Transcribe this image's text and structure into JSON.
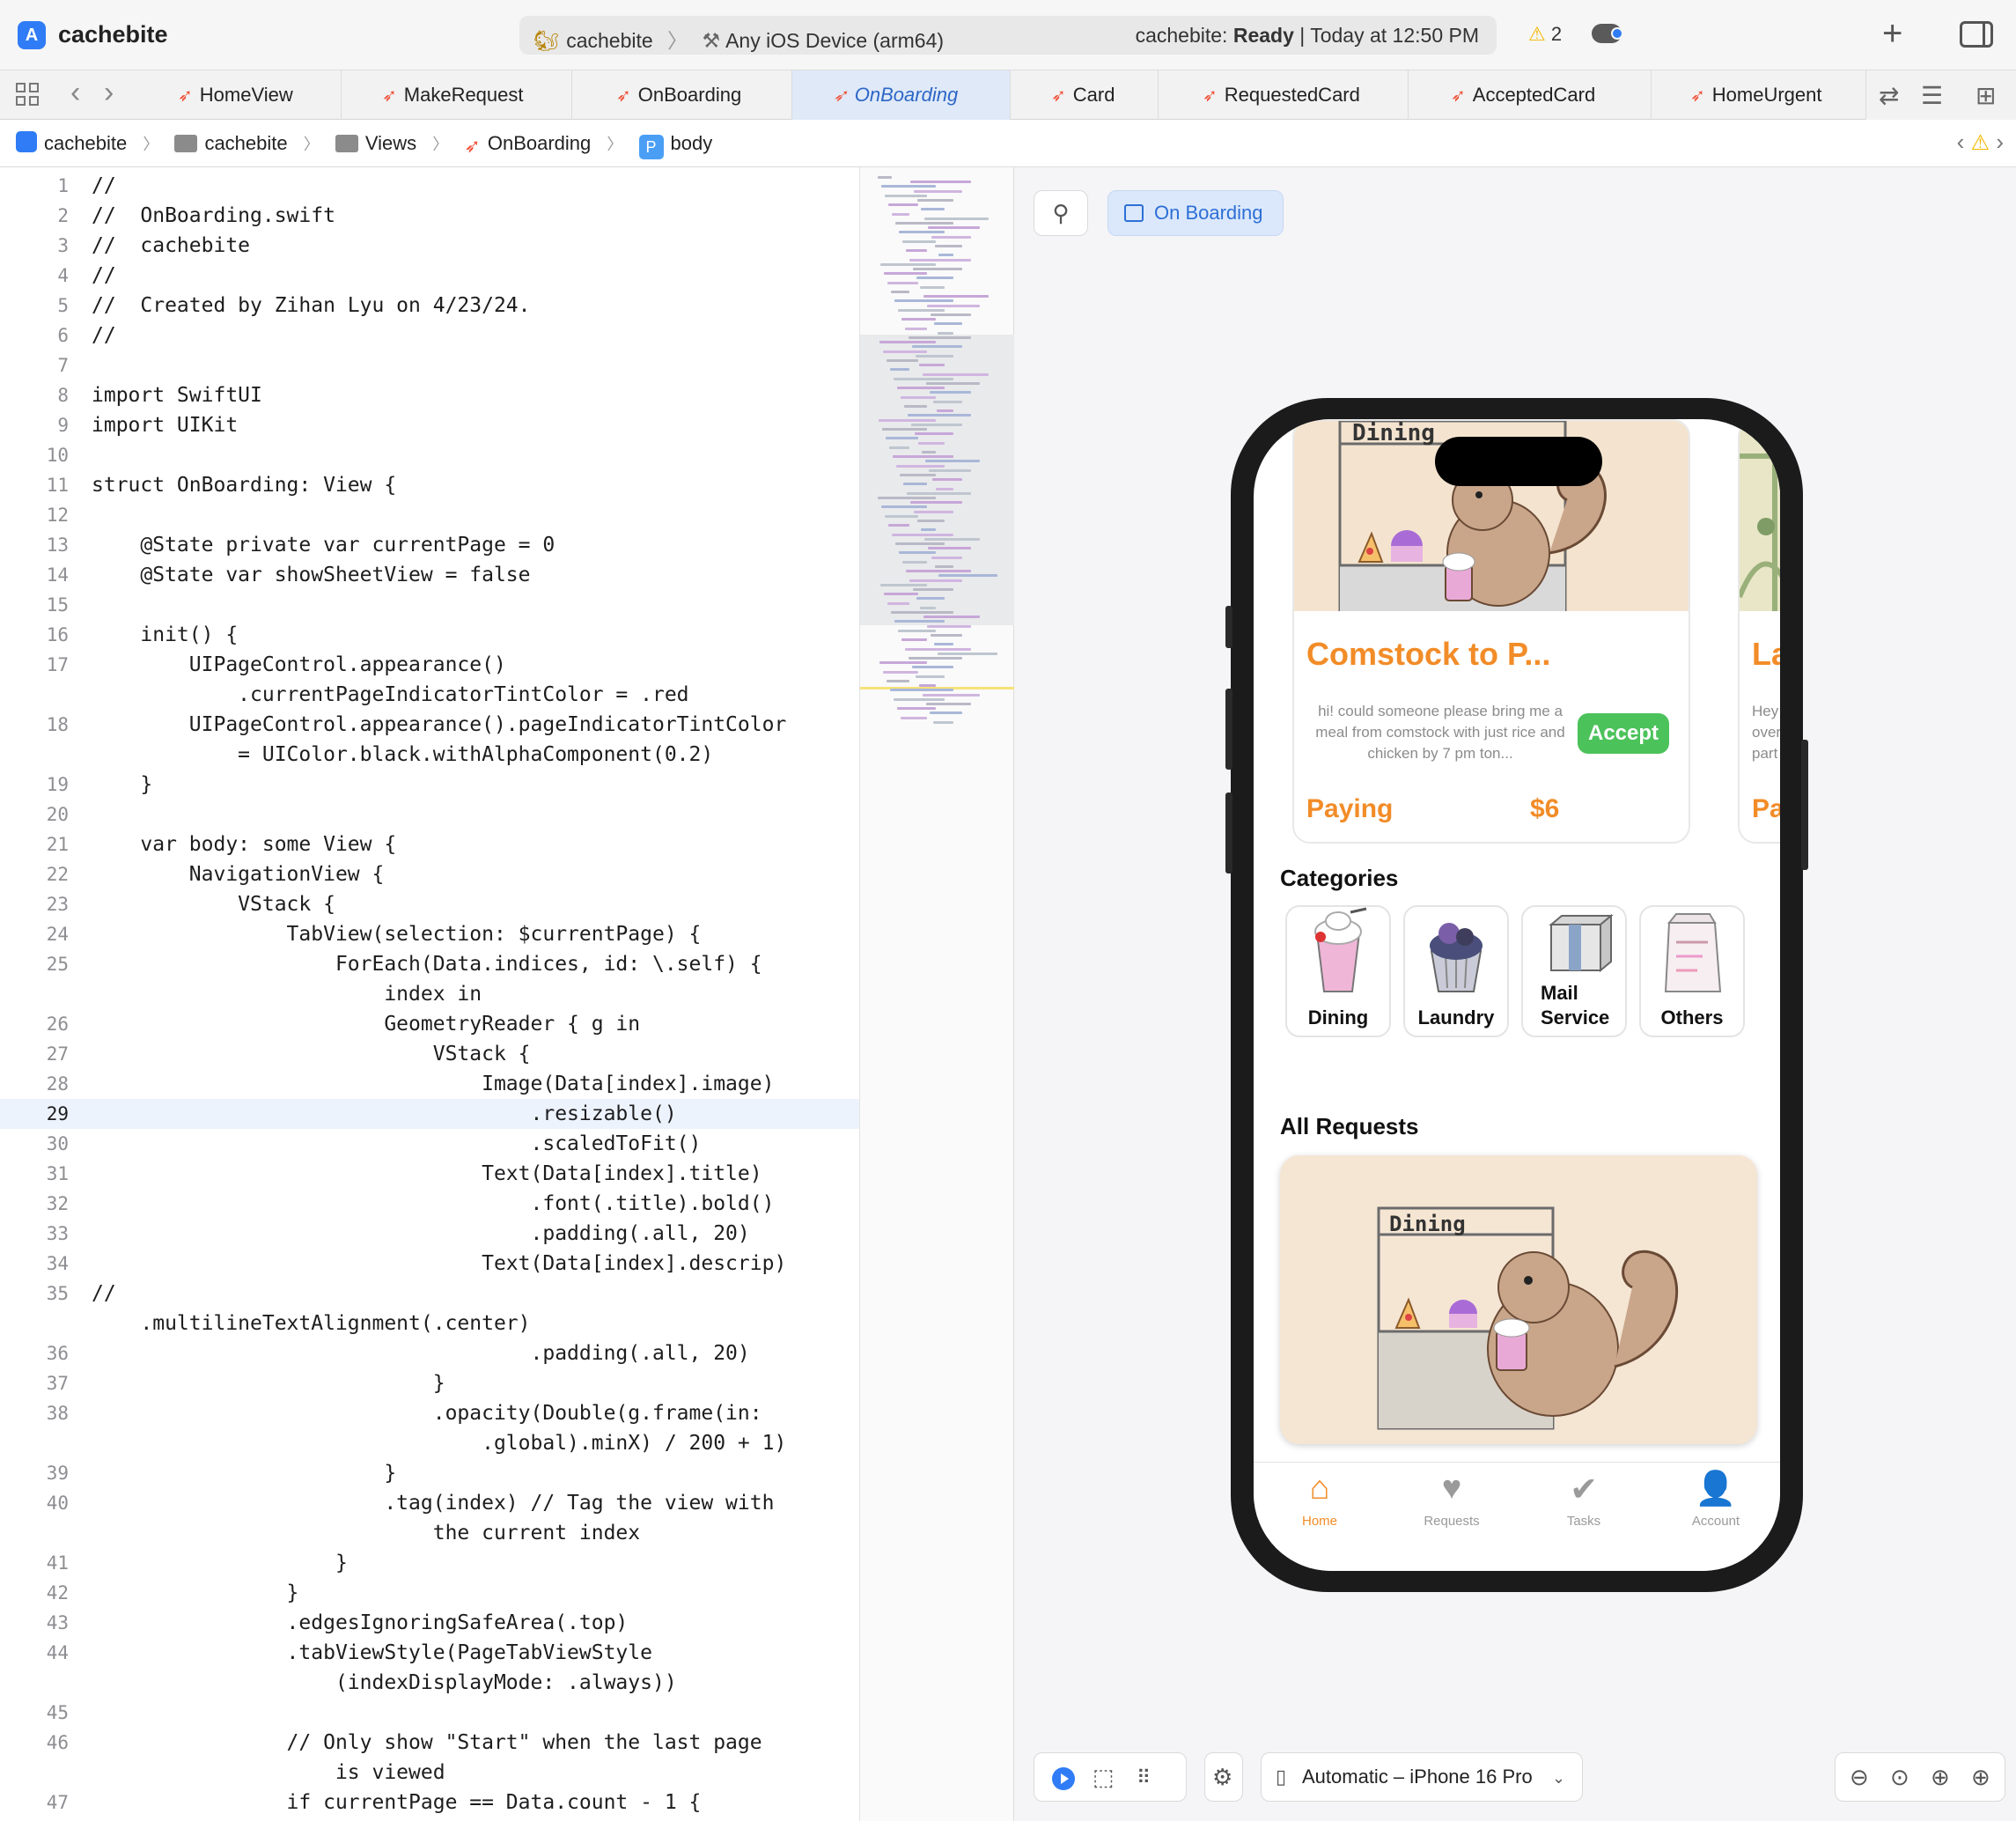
{
  "titlebar": {
    "app_name": "cachebite",
    "scheme": "cachebite",
    "destination": "Any iOS Device (arm64)",
    "status_project": "cachebite:",
    "status_state": "Ready",
    "status_time": "| Today at 12:50 PM",
    "warning_count": "2"
  },
  "tabs": [
    {
      "label": "HomeView"
    },
    {
      "label": "MakeRequest"
    },
    {
      "label": "OnBoarding"
    },
    {
      "label": "OnBoarding"
    },
    {
      "label": "Card"
    },
    {
      "label": "RequestedCard"
    },
    {
      "label": "AcceptedCard"
    },
    {
      "label": "HomeUrgent"
    }
  ],
  "breadcrumb": [
    "cachebite",
    "cachebite",
    "Views",
    "OnBoarding",
    "body"
  ],
  "editor": {
    "lines": [
      {
        "n": "1",
        "t": "//"
      },
      {
        "n": "2",
        "t": "//  OnBoarding.swift"
      },
      {
        "n": "3",
        "t": "//  cachebite"
      },
      {
        "n": "4",
        "t": "//"
      },
      {
        "n": "5",
        "t": "//  Created by Zihan Lyu on 4/23/24."
      },
      {
        "n": "6",
        "t": "//"
      },
      {
        "n": "7",
        "t": ""
      },
      {
        "n": "8",
        "t": "import SwiftUI"
      },
      {
        "n": "9",
        "t": "import UIKit"
      },
      {
        "n": "10",
        "t": ""
      },
      {
        "n": "11",
        "t": "struct OnBoarding: View {"
      },
      {
        "n": "12",
        "t": ""
      },
      {
        "n": "13",
        "t": "    @State private var currentPage = 0"
      },
      {
        "n": "14",
        "t": "    @State var showSheetView = false"
      },
      {
        "n": "15",
        "t": ""
      },
      {
        "n": "16",
        "t": "    init() {"
      },
      {
        "n": "17",
        "t": "        UIPageControl.appearance()"
      },
      {
        "n": "",
        "t": "            .currentPageIndicatorTintColor = .red"
      },
      {
        "n": "18",
        "t": "        UIPageControl.appearance().pageIndicatorTintColor"
      },
      {
        "n": "",
        "t": "            = UIColor.black.withAlphaComponent(0.2)"
      },
      {
        "n": "19",
        "t": "    }"
      },
      {
        "n": "20",
        "t": ""
      },
      {
        "n": "21",
        "t": "    var body: some View {"
      },
      {
        "n": "22",
        "t": "        NavigationView {"
      },
      {
        "n": "23",
        "t": "            VStack {"
      },
      {
        "n": "24",
        "t": "                TabView(selection: $currentPage) {"
      },
      {
        "n": "25",
        "t": "                    ForEach(Data.indices, id: \\.self) {"
      },
      {
        "n": "",
        "t": "                        index in"
      },
      {
        "n": "26",
        "t": "                        GeometryReader { g in"
      },
      {
        "n": "27",
        "t": "                            VStack {"
      },
      {
        "n": "28",
        "t": "                                Image(Data[index].image)"
      },
      {
        "n": "29",
        "t": "                                    .resizable()"
      },
      {
        "n": "30",
        "t": "                                    .scaledToFit()"
      },
      {
        "n": "31",
        "t": "                                Text(Data[index].title)"
      },
      {
        "n": "32",
        "t": "                                    .font(.title).bold()"
      },
      {
        "n": "33",
        "t": "                                    .padding(.all, 20)"
      },
      {
        "n": "34",
        "t": "                                Text(Data[index].descrip)"
      },
      {
        "n": "35",
        "t": "//"
      },
      {
        "n": "",
        "t": "    .multilineTextAlignment(.center)"
      },
      {
        "n": "36",
        "t": "                                    .padding(.all, 20)"
      },
      {
        "n": "37",
        "t": "                            }"
      },
      {
        "n": "38",
        "t": "                            .opacity(Double(g.frame(in:"
      },
      {
        "n": "",
        "t": "                                .global).minX) / 200 + 1)"
      },
      {
        "n": "39",
        "t": "                        }"
      },
      {
        "n": "40",
        "t": "                        .tag(index) // Tag the view with"
      },
      {
        "n": "",
        "t": "                            the current index"
      },
      {
        "n": "41",
        "t": "                    }"
      },
      {
        "n": "42",
        "t": "                }"
      },
      {
        "n": "43",
        "t": "                .edgesIgnoringSafeArea(.top)"
      },
      {
        "n": "44",
        "t": "                .tabViewStyle(PageTabViewStyle"
      },
      {
        "n": "",
        "t": "                    (indexDisplayMode: .always))"
      },
      {
        "n": "45",
        "t": ""
      },
      {
        "n": "46",
        "t": "                // Only show \"Start\" when the last page"
      },
      {
        "n": "",
        "t": "                    is viewed"
      },
      {
        "n": "47",
        "t": "                if currentPage == Data.count - 1 {"
      }
    ]
  },
  "preview": {
    "preview_name": "On Boarding",
    "device": "Automatic – iPhone 16 Pro",
    "card": {
      "title": "Comstock to P...",
      "description": "hi! could someone please bring me a meal from comstock with just rice and chicken by 7 pm ton...",
      "accept": "Accept",
      "paying": "Paying",
      "price": "$6",
      "image_text": "Dining"
    },
    "card_peek": {
      "title": "La",
      "desc": "Hey\nover\npart",
      "paying": "Pa"
    },
    "categories_title": "Categories",
    "categories": [
      "Dining",
      "Laundry",
      "Mail\nService",
      "Others"
    ],
    "all_requests_title": "All Requests",
    "all_card_text": "Dining",
    "tabs": [
      {
        "label": "Home",
        "icon": "house-icon"
      },
      {
        "label": "Requests",
        "icon": "heart-icon"
      },
      {
        "label": "Tasks",
        "icon": "checkmark-circle-icon"
      },
      {
        "label": "Account",
        "icon": "person-icon"
      }
    ]
  },
  "colors": {
    "accent_orange": "#f28c28",
    "accept_green": "#4cc25b",
    "xcode_blue": "#2f7cf6",
    "swift_orange": "#f05138"
  }
}
